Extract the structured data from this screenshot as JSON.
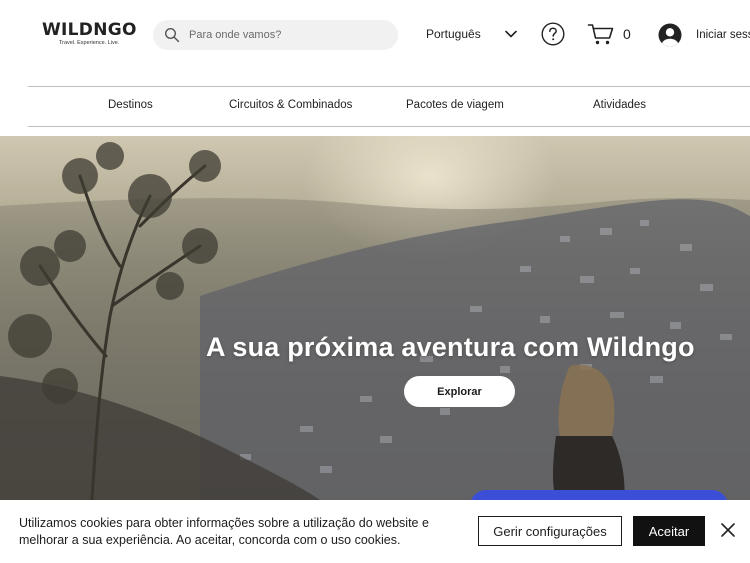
{
  "header": {
    "logo": {
      "name": "WILDNGO",
      "tagline": "Travel. Experience. Live."
    },
    "search": {
      "placeholder": "Para onde vamos?",
      "value": ""
    },
    "language": {
      "selected": "Português"
    },
    "cart": {
      "count": "0"
    },
    "login": {
      "label": "Iniciar sessão"
    }
  },
  "nav": {
    "items": [
      {
        "label": "Destinos"
      },
      {
        "label": "Circuitos & Combinados"
      },
      {
        "label": "Pacotes de viagem"
      },
      {
        "label": "Atividades"
      }
    ]
  },
  "hero": {
    "title": "A sua próxima aventura com Wildngo",
    "button_label": "Explorar"
  },
  "cookie_banner": {
    "text": "Utilizamos cookies para obter informações sobre a utilização do website e melhorar a sua experiência. Ao aceitar, concorda com o uso cookies.",
    "manage_label": "Gerir configurações",
    "accept_label": "Aceitar"
  },
  "colors": {
    "accent_dark": "#111111",
    "chat_widget": "#3a4fd6",
    "search_bg": "#f1f1f1"
  },
  "icons": [
    "search-icon",
    "chevron-down-icon",
    "help-icon",
    "cart-icon",
    "avatar-icon",
    "close-icon"
  ]
}
